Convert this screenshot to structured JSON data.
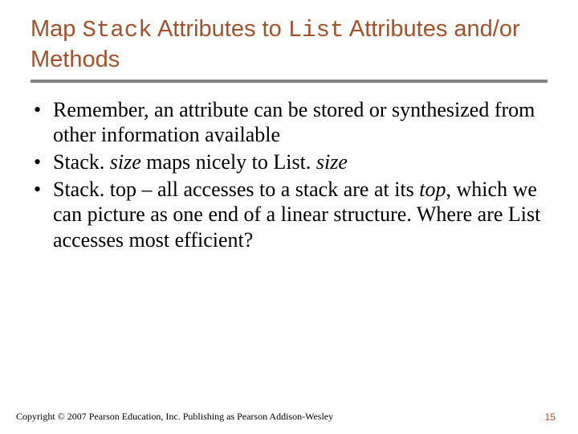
{
  "title": {
    "parts": [
      {
        "text": "Map ",
        "mono": false
      },
      {
        "text": "Stack",
        "mono": true
      },
      {
        "text": " Attributes to ",
        "mono": false
      },
      {
        "text": "List",
        "mono": true
      },
      {
        "text": " Attributes and/or Methods",
        "mono": false
      }
    ]
  },
  "bullets": [
    {
      "runs": [
        {
          "text": "Remember, an attribute can be stored or synthesized from other information available",
          "italic": false
        }
      ]
    },
    {
      "runs": [
        {
          "text": "Stack. ",
          "italic": false
        },
        {
          "text": "size",
          "italic": true
        },
        {
          "text": " maps nicely to List. ",
          "italic": false
        },
        {
          "text": "size",
          "italic": true
        }
      ]
    },
    {
      "runs": [
        {
          "text": "Stack. top – all accesses to a stack are at its ",
          "italic": false
        },
        {
          "text": "top",
          "italic": true
        },
        {
          "text": ", which we can picture as one end of a linear structure. Where are List accesses most efficient?",
          "italic": false
        }
      ]
    }
  ],
  "footer": "Copyright © 2007 Pearson Education, Inc. Publishing as Pearson Addison-Wesley",
  "page_number": "15"
}
